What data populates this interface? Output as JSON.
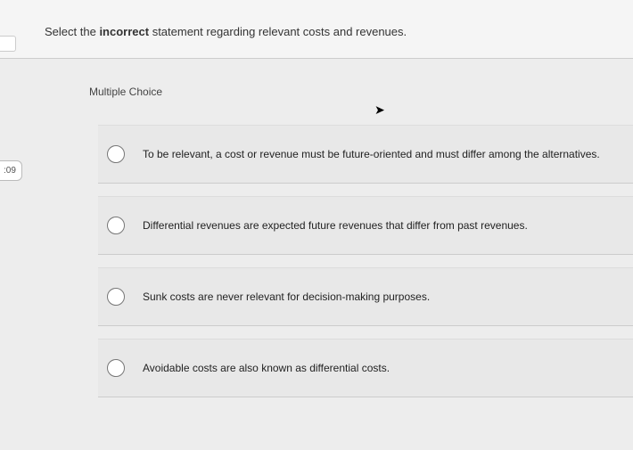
{
  "question": {
    "prefix": "Select the ",
    "bold": "incorrect",
    "suffix": " statement regarding relevant costs and revenues."
  },
  "section_label": "Multiple Choice",
  "side_tab": ":09",
  "options": [
    "To be relevant, a cost or revenue must be future-oriented and must differ among the alternatives.",
    "Differential revenues are expected future revenues that differ from past revenues.",
    "Sunk costs are never relevant for decision-making purposes.",
    "Avoidable costs are also known as differential costs."
  ]
}
